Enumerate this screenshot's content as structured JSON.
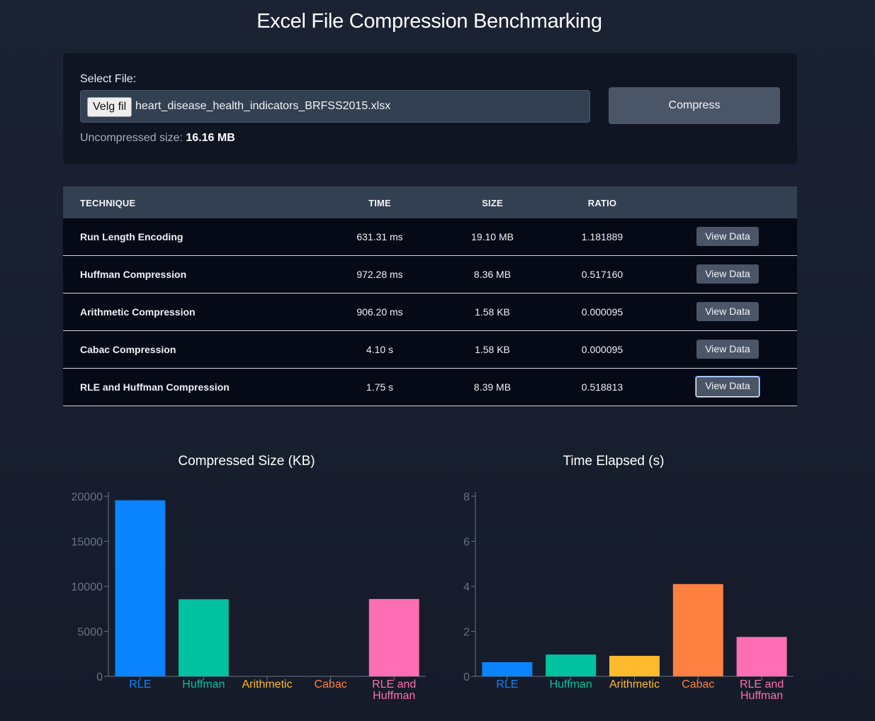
{
  "title": "Excel File Compression Benchmarking",
  "file_panel": {
    "select_label": "Select File:",
    "choose_button": "Velg fil",
    "file_name": "heart_disease_health_indicators_BRFSS2015.xlsx",
    "compress_button": "Compress",
    "size_label": "Uncompressed size:",
    "size_value": "16.16 MB"
  },
  "table": {
    "headers": [
      "TECHNIQUE",
      "TIME",
      "SIZE",
      "RATIO"
    ],
    "rows": [
      {
        "technique": "Run Length Encoding",
        "time": "631.31 ms",
        "size": "19.10 MB",
        "ratio": "1.181889",
        "action": "View Data"
      },
      {
        "technique": "Huffman Compression",
        "time": "972.28 ms",
        "size": "8.36 MB",
        "ratio": "0.517160",
        "action": "View Data"
      },
      {
        "technique": "Arithmetic Compression",
        "time": "906.20 ms",
        "size": "1.58 KB",
        "ratio": "0.000095",
        "action": "View Data"
      },
      {
        "technique": "Cabac Compression",
        "time": "4.10 s",
        "size": "1.58 KB",
        "ratio": "0.000095",
        "action": "View Data"
      },
      {
        "technique": "RLE and Huffman Compression",
        "time": "1.75 s",
        "size": "8.39 MB",
        "ratio": "0.518813",
        "action": "View Data"
      }
    ]
  },
  "colors": [
    "#0a84ff",
    "#00c2a0",
    "#ffbb2c",
    "#ff8040",
    "#ff6eb4"
  ],
  "chart_data": [
    {
      "type": "bar",
      "title": "Compressed Size (KB)",
      "categories": [
        "RLE",
        "Huffman",
        "Arithmetic",
        "Cabac",
        "RLE and Huffman"
      ],
      "values": [
        19558,
        8560,
        1.58,
        1.58,
        8591
      ],
      "yticks": [
        0,
        5000,
        10000,
        15000,
        20000
      ],
      "ylim": [
        0,
        20000
      ]
    },
    {
      "type": "bar",
      "title": "Time Elapsed (s)",
      "categories": [
        "RLE",
        "Huffman",
        "Arithmetic",
        "Cabac",
        "RLE and Huffman"
      ],
      "values": [
        0.63,
        0.97,
        0.91,
        4.1,
        1.75
      ],
      "yticks": [
        0,
        2,
        4,
        6,
        8
      ],
      "ylim": [
        0,
        8
      ]
    }
  ]
}
